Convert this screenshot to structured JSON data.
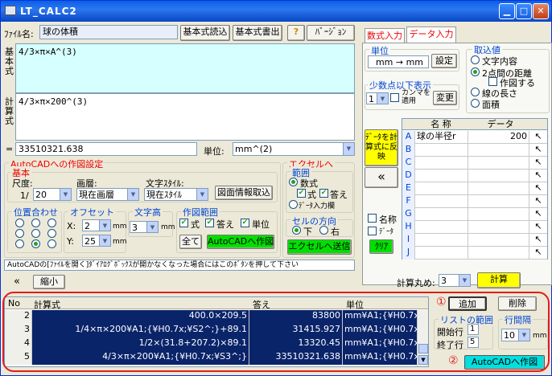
{
  "window": {
    "title": "LT_CALC2"
  },
  "toolbar": {
    "file_label": "ﾌｧｲﾙ名:",
    "file_value": "球の体積",
    "load_btn": "基本式読込",
    "write_btn": "基本式書出",
    "help_btn": "?",
    "version_btn": "ﾊﾞｰｼﾞｮﾝ"
  },
  "side": {
    "kihon": "基本式",
    "keisan": "計算式"
  },
  "formula": {
    "basic": "4/3×π×A^(3)",
    "calc": "4/3×π×200^(3)"
  },
  "result": {
    "eq": "=",
    "value": "33510321.638",
    "unit_label": "単位:",
    "unit_value": "mm^(2)"
  },
  "tabs": {
    "formula": "数式入力",
    "data": "データ入力"
  },
  "unit": {
    "title": "単位",
    "value": "mm → mm",
    "btn": "設定"
  },
  "decimal": {
    "title": "少数点以下表示",
    "value": "1",
    "comma": "カンマを適用",
    "btn": "変更"
  },
  "take": {
    "title": "取込値",
    "opt1": "文字内容",
    "opt2": "2点間の距離",
    "opt2sub": "作図する",
    "opt3": "線の長さ",
    "opt4": "面積"
  },
  "datagrid": {
    "col_name": "名 称",
    "col_data": "データ",
    "rows": [
      {
        "k": "A",
        "name": "球の半径r",
        "val": "200"
      },
      {
        "k": "B",
        "name": "",
        "val": ""
      },
      {
        "k": "C",
        "name": "",
        "val": ""
      },
      {
        "k": "D",
        "name": "",
        "val": ""
      },
      {
        "k": "E",
        "name": "",
        "val": ""
      },
      {
        "k": "F",
        "name": "",
        "val": ""
      },
      {
        "k": "G",
        "name": "",
        "val": ""
      },
      {
        "k": "H",
        "name": "",
        "val": ""
      },
      {
        "k": "I",
        "name": "",
        "val": ""
      },
      {
        "k": "J",
        "name": "",
        "val": ""
      }
    ]
  },
  "reflect_btn": "ﾃﾞｰﾀを計算式に反映",
  "chevron": "«",
  "name_chk": "名称",
  "data_chk": "ﾃﾞｰﾀ",
  "clear_btn": "ｸﾘｱ",
  "acad": {
    "title": "AutoCADへの作図設定",
    "basic_title": "基本",
    "scale_label": "尺度:",
    "scale_prefix": "1/",
    "scale_value": "20",
    "layer_label": "画層:",
    "layer_value": "現在画層",
    "style_label": "文字ｽﾀｲﾙ:",
    "style_value": "現在ｽﾀｲﾙ",
    "fig_btn": "図面情報取込",
    "align_title": "位置合わせ",
    "offset_title": "オフセット",
    "x_label": "X:",
    "x_value": "2",
    "y_label": "Y:",
    "y_value": "25",
    "mm": "mm",
    "textheight_title": "文字高",
    "th_value": "3",
    "range_title": "作図範囲",
    "r_formula": "式",
    "r_answer": "答え",
    "r_unit": "単位",
    "all_btn": "全て",
    "draw_btn": "AutoCADへ作図"
  },
  "excel": {
    "title": "エクセルへ",
    "range_title": "範囲",
    "opt_formula": "数式",
    "c_formula": "式",
    "c_answer": "答え",
    "opt_data": "ﾃﾞｰﾀ入力欄",
    "cell_title": "セルの方向",
    "down": "下",
    "right": "右",
    "send_btn": "エクセルへ送信"
  },
  "notice": "AutoCADの[ﾌｧｲﾙを開く]ﾀﾞｲｱﾛｸﾞﾎﾞｯｸｽが開かなくなった場合にはこのﾎﾞﾀﾝを押して下さい",
  "calc_round_label": "計算丸め:",
  "calc_round_value": "3",
  "calc_btn": "計算",
  "shrink": {
    "arrows": "«",
    "label": "縮小"
  },
  "list": {
    "headers": [
      "No",
      "計算式",
      "答え",
      "単位"
    ],
    "rows": [
      {
        "no": "2",
        "f": "400.0×209.5",
        "a": "83800",
        "u": "mm¥A1;{¥H0.7x;¥S2"
      },
      {
        "no": "3",
        "f": "1/4×π×200¥A1;{¥H0.7x;¥S2^;}+89.1",
        "a": "31415.927",
        "u": "mm¥A1;{¥H0.7x;¥S2"
      },
      {
        "no": "4",
        "f": "1/2×(31.8+207.2)×89.1",
        "a": "13320.45",
        "u": "mm¥A1;{¥H0.7x;¥S2"
      },
      {
        "no": "5",
        "f": "4/3×π×200¥A1;{¥H0.7x;¥S3^;}",
        "a": "33510321.638",
        "u": "mm¥A1;{¥H0.7x;¥S3"
      }
    ]
  },
  "listpanel": {
    "mark1": "①",
    "add_btn": "追加",
    "del_btn": "削除",
    "range_title": "リストの範囲",
    "start_label": "開始行",
    "start_val": "1",
    "end_label": "終了行",
    "end_val": "5",
    "spacing_title": "行間隔",
    "spacing_val": "10",
    "mm": "mm",
    "mark2": "②",
    "draw_btn": "AutoCADへ作図"
  },
  "colors": {
    "accent": "#0046d5",
    "selection": "#0a246a",
    "highlight_ring": "#e21c1c",
    "cyan_field": "#d6ffff"
  }
}
